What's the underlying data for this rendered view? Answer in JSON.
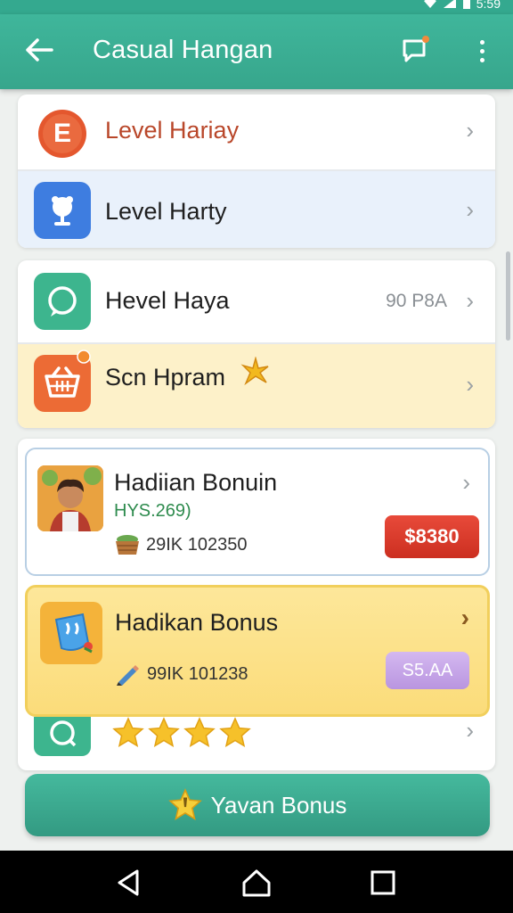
{
  "statusbar": {
    "time": "5:59"
  },
  "appbar": {
    "title": "Casual Hangan"
  },
  "section1": {
    "row1": {
      "label": "Level Hariay",
      "icon_letter": "E"
    },
    "row2": {
      "label": "Level Harty"
    }
  },
  "section2": {
    "row1": {
      "label": "Hevel Haya",
      "value": "90 P8A"
    },
    "row2": {
      "label": "Scn Hpram"
    }
  },
  "section3": {
    "bonus1": {
      "title": "Hadiian Bonuin",
      "subtitle": "HYS.269)",
      "meta": "29IK 102350",
      "price": "$8380"
    },
    "bonus2": {
      "title": "Hadikan Bonus",
      "meta": "99IK 101238",
      "price": "S5.AA"
    },
    "rating": {
      "stars": 4
    }
  },
  "bottom_button": {
    "label": "Yavan Bonus"
  },
  "colors": {
    "accent": "#37a68c",
    "orange": "#e4572e",
    "red_price": "#dd3a2a",
    "purple_price": "#c6a6e8",
    "yellow_card": "#fbe38c",
    "blue_row": "#e9f1fb",
    "beige_row": "#fdf1c9"
  }
}
